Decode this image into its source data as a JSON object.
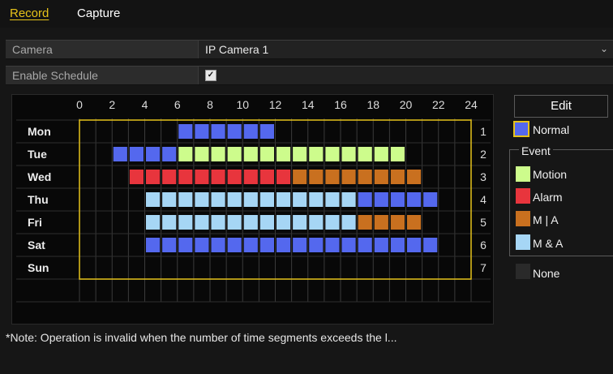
{
  "tabs": [
    {
      "label": "Record",
      "active": true
    },
    {
      "label": "Capture",
      "active": false
    }
  ],
  "camera": {
    "label": "Camera",
    "value": "IP Camera 1"
  },
  "enable_schedule": {
    "label": "Enable Schedule",
    "checked": true
  },
  "schedule": {
    "hour_ticks": [
      "0",
      "2",
      "4",
      "6",
      "8",
      "10",
      "12",
      "14",
      "16",
      "18",
      "20",
      "22",
      "24"
    ],
    "days": [
      {
        "name": "Mon",
        "number": "1",
        "segments": [
          {
            "start": 6,
            "end": 12,
            "type": "normal"
          }
        ]
      },
      {
        "name": "Tue",
        "number": "2",
        "segments": [
          {
            "start": 2,
            "end": 6,
            "type": "normal"
          },
          {
            "start": 6,
            "end": 20,
            "type": "motion"
          }
        ]
      },
      {
        "name": "Wed",
        "number": "3",
        "segments": [
          {
            "start": 3,
            "end": 13,
            "type": "alarm"
          },
          {
            "start": 13,
            "end": 21,
            "type": "m_or_a"
          }
        ]
      },
      {
        "name": "Thu",
        "number": "4",
        "segments": [
          {
            "start": 4,
            "end": 17,
            "type": "m_and_a"
          },
          {
            "start": 17,
            "end": 22,
            "type": "normal"
          }
        ]
      },
      {
        "name": "Fri",
        "number": "5",
        "segments": [
          {
            "start": 4,
            "end": 17,
            "type": "m_and_a"
          },
          {
            "start": 17,
            "end": 21,
            "type": "m_or_a"
          }
        ]
      },
      {
        "name": "Sat",
        "number": "6",
        "segments": [
          {
            "start": 4,
            "end": 22,
            "type": "normal"
          }
        ]
      },
      {
        "name": "Sun",
        "number": "7",
        "segments": []
      }
    ]
  },
  "edit_button": "Edit",
  "legend": {
    "normal": "Normal",
    "event_title": "Event",
    "motion": "Motion",
    "alarm": "Alarm",
    "m_or_a": "M | A",
    "m_and_a": "M & A",
    "none": "None"
  },
  "colors": {
    "normal": "#5468ee",
    "motion": "#cdfc8c",
    "alarm": "#e8353d",
    "m_or_a": "#c9701f",
    "m_and_a": "#a6d6f5",
    "none": "#2a2a2a",
    "accent": "#e6c21a"
  },
  "note": "*Note: Operation is invalid when the number of time segments exceeds the l..."
}
